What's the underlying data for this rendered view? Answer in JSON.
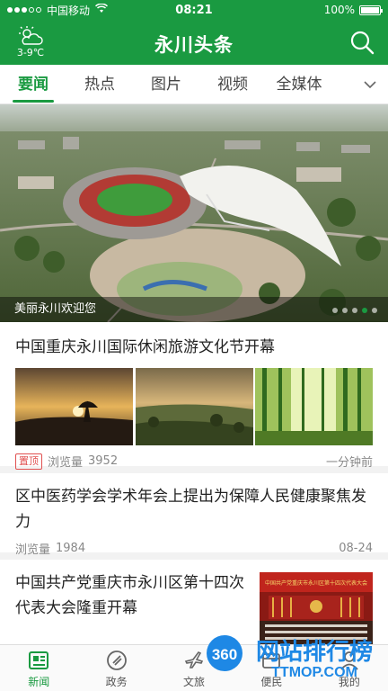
{
  "status_bar": {
    "carrier": "中国移动",
    "time": "08:21",
    "battery": "100%"
  },
  "header": {
    "title": "永川头条",
    "weather_temp": "3-9℃"
  },
  "tabs": [
    {
      "label": "要闻",
      "active": true
    },
    {
      "label": "热点",
      "active": false
    },
    {
      "label": "图片",
      "active": false
    },
    {
      "label": "视频",
      "active": false
    },
    {
      "label": "全媒体",
      "active": false
    }
  ],
  "banner": {
    "caption": "美丽永川欢迎您",
    "slide_index": 4,
    "slide_count": 5
  },
  "feed": [
    {
      "title": "中国重庆永川国际休闲旅游文化节开幕",
      "tag": "置顶",
      "views_label": "浏览量",
      "views": "3952",
      "time": "一分钟前"
    },
    {
      "title": "区中医药学会学术年会上提出为保障人民健康聚焦发力",
      "views_label": "浏览量",
      "views": "1984",
      "time": "08-24"
    },
    {
      "title": "中国共产党重庆市永川区第十四次代表大会隆重开幕",
      "image_text": "中国共产党重庆市永川区第十四次代表大会"
    }
  ],
  "bottom_nav": [
    {
      "label": "新闻",
      "icon": "news-icon",
      "active": true
    },
    {
      "label": "政务",
      "icon": "government-icon",
      "active": false
    },
    {
      "label": "文旅",
      "icon": "travel-icon",
      "active": false
    },
    {
      "label": "便民",
      "icon": "service-icon",
      "active": false
    },
    {
      "label": "我的",
      "icon": "profile-icon",
      "active": false
    }
  ],
  "watermark": {
    "badge": "360",
    "text": "网站排行榜",
    "url": "TTMOP.COM"
  },
  "colors": {
    "brand_green": "#1a9a41",
    "tag_red": "#e05050"
  }
}
